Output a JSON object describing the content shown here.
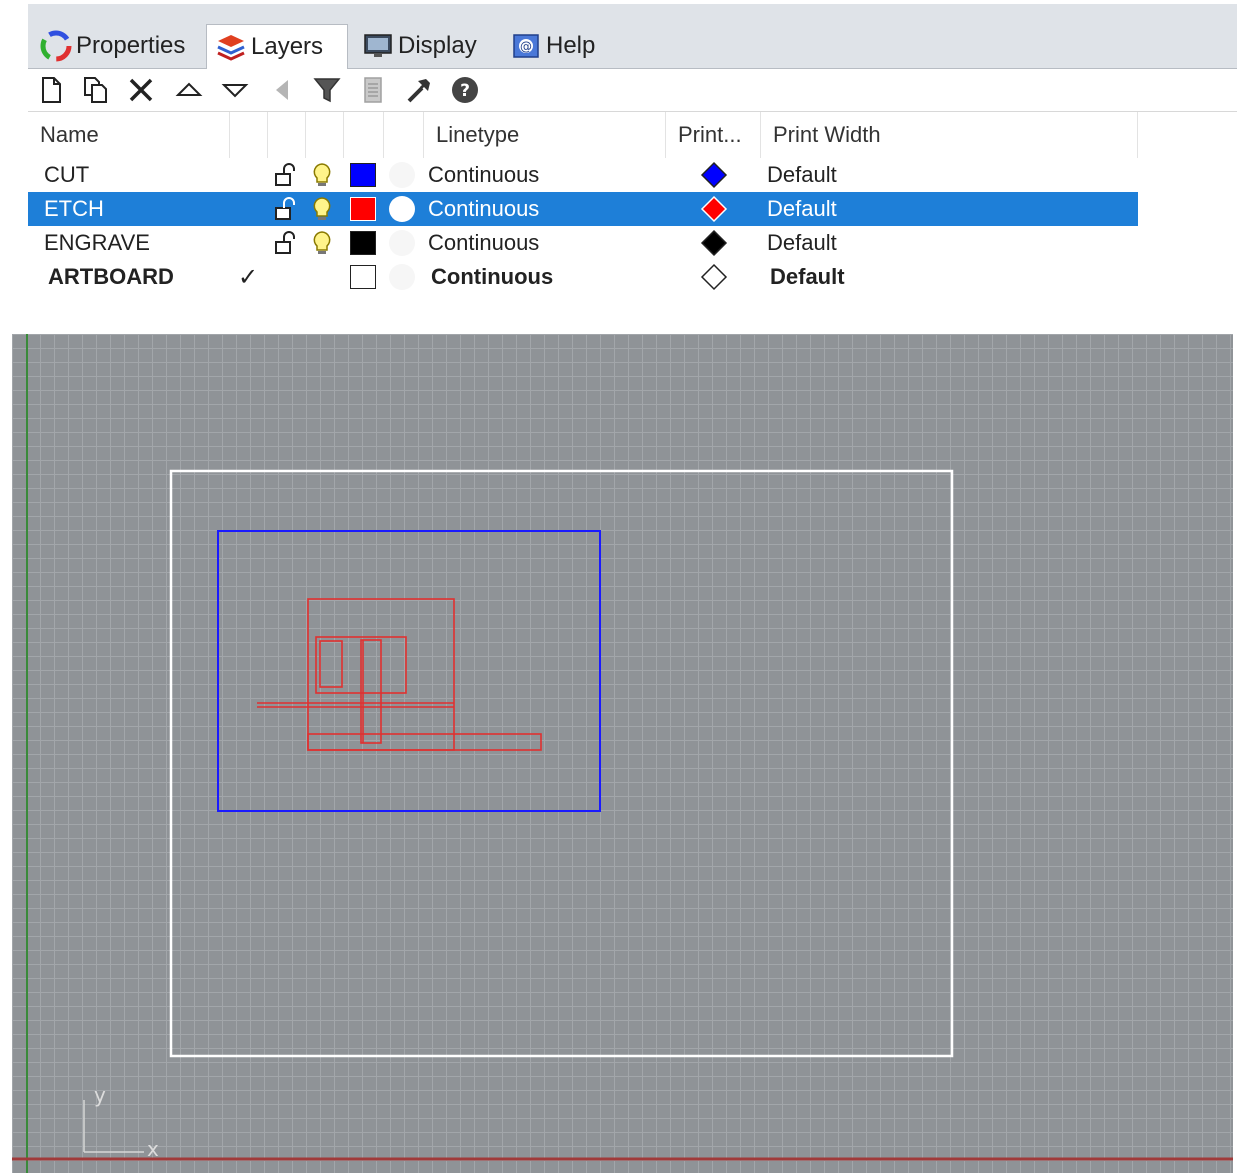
{
  "tabs": [
    {
      "label": "Properties",
      "icon": "color-wheel-icon",
      "active": false
    },
    {
      "label": "Layers",
      "icon": "layers-icon",
      "active": true
    },
    {
      "label": "Display",
      "icon": "monitor-icon",
      "active": false
    },
    {
      "label": "Help",
      "icon": "help-book-icon",
      "active": false
    }
  ],
  "toolbar": {
    "buttons": [
      "new-layer-icon",
      "new-sublayer-icon",
      "delete-icon",
      "move-up-icon",
      "move-down-icon",
      "move-left-icon",
      "filter-icon",
      "document-icon",
      "tools-icon",
      "help-icon"
    ]
  },
  "columns": {
    "name": "Name",
    "linetype": "Linetype",
    "print_color": "Print...",
    "print_width": "Print Width"
  },
  "layers": [
    {
      "name": "CUT",
      "current": false,
      "linetype": "Continuous",
      "print_width": "Default",
      "color": "#0000ff",
      "print_color": "#0000ff"
    },
    {
      "name": "ETCH",
      "current": false,
      "linetype": "Continuous",
      "print_width": "Default",
      "color": "#ff0000",
      "print_color": "#ff0000"
    },
    {
      "name": "ENGRAVE",
      "current": false,
      "linetype": "Continuous",
      "print_width": "Default",
      "color": "#000000",
      "print_color": "#000000"
    },
    {
      "name": "ARTBOARD",
      "current": true,
      "current_mark": "✓",
      "linetype": "Continuous",
      "print_width": "Default",
      "color": "#ffffff",
      "print_color": "#ffffff"
    }
  ],
  "selected_layer": "ETCH",
  "viewport": {
    "axis_x_label": "x",
    "axis_y_label": "y",
    "background": "#8f9397",
    "artboard_color": "#ffffff",
    "cut_color": "#1a1aff",
    "etch_color": "#e03030"
  }
}
